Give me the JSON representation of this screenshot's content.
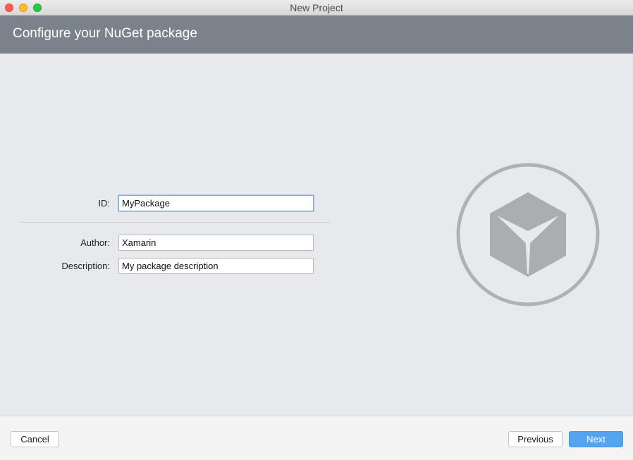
{
  "window": {
    "title": "New Project"
  },
  "header": {
    "title": "Configure your NuGet package"
  },
  "form": {
    "id": {
      "label": "ID:",
      "value": "MyPackage"
    },
    "author": {
      "label": "Author:",
      "value": "Xamarin"
    },
    "description": {
      "label": "Description:",
      "value": "My package description"
    }
  },
  "illustration": {
    "icon": "package-box-icon"
  },
  "footer": {
    "cancel_label": "Cancel",
    "previous_label": "Previous",
    "next_label": "Next"
  },
  "colors": {
    "header_bg": "#7a838b",
    "primary_button": "#53a5ef",
    "body_bg": "#e7e9ec"
  }
}
